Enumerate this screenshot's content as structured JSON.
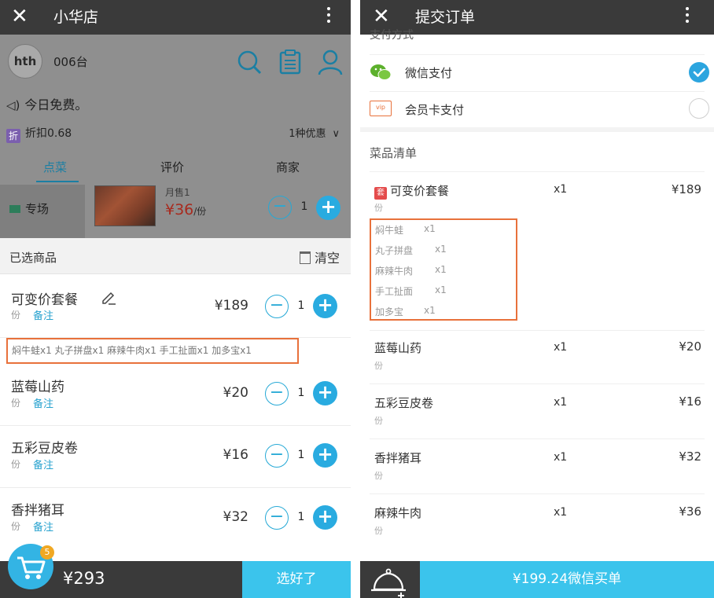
{
  "left": {
    "titlebar": {
      "close": "✕",
      "title": "小华店"
    },
    "store": {
      "logo": "hth",
      "table_no": "006台"
    },
    "notice": "今日免费。",
    "discount": {
      "badge": "折",
      "text": "折扣0.68"
    },
    "promo": {
      "text": "1种优惠",
      "chevron": "∨"
    },
    "tabs": [
      {
        "label": "点菜",
        "active": true
      },
      {
        "label": "评价"
      },
      {
        "label": "商家"
      }
    ],
    "category": "专场",
    "featured": {
      "sold": "月售1",
      "price": "¥36",
      "unit": "/份",
      "qty": "1"
    },
    "selected": {
      "title": "已选商品",
      "clear": "清空",
      "items": [
        {
          "name": "可变价套餐",
          "unit": "份",
          "note": "备注",
          "price": "¥189",
          "qty": "1"
        },
        {
          "name": "蓝莓山药",
          "unit": "份",
          "note": "备注",
          "price": "¥20",
          "qty": "1"
        },
        {
          "name": "五彩豆皮卷",
          "unit": "份",
          "note": "备注",
          "price": "¥16",
          "qty": "1"
        },
        {
          "name": "香拌猪耳",
          "unit": "份",
          "note": "备注",
          "price": "¥32",
          "qty": "1"
        }
      ],
      "subitems": "焖牛蛙x1  丸子拼盘x1  麻辣牛肉x1  手工扯面x1  加多宝x1"
    },
    "bottom": {
      "cart_count": "5",
      "total": "¥293",
      "done": "选好了"
    }
  },
  "right": {
    "titlebar": {
      "close": "✕",
      "title": "提交订单"
    },
    "payment_section": "支付方式",
    "payments": [
      {
        "label": "微信支付",
        "selected": true
      },
      {
        "label": "会员卡支付",
        "selected": false
      }
    ],
    "vip_icon": "vip",
    "menu_section": "菜品清单",
    "items": [
      {
        "badge": "套",
        "name": "可变价套餐",
        "unit": "份",
        "qty": "x1",
        "price": "¥189"
      },
      {
        "name": "蓝莓山药",
        "unit": "份",
        "qty": "x1",
        "price": "¥20"
      },
      {
        "name": "五彩豆皮卷",
        "unit": "份",
        "qty": "x1",
        "price": "¥16"
      },
      {
        "name": "香拌猪耳",
        "unit": "份",
        "qty": "x1",
        "price": "¥32"
      },
      {
        "name": "麻辣牛肉",
        "unit": "份",
        "qty": "x1",
        "price": "¥36"
      }
    ],
    "subitems": [
      {
        "name": "焖牛蛙",
        "qty": "x1"
      },
      {
        "name": "丸子拼盘",
        "qty": "x1"
      },
      {
        "name": "麻辣牛肉",
        "qty": "x1"
      },
      {
        "name": "手工扯面",
        "qty": "x1"
      },
      {
        "name": "加多宝",
        "qty": "x1"
      }
    ],
    "bottom": {
      "pay": "¥199.24微信买单"
    }
  },
  "colors": {
    "accent": "#29abe0",
    "price_red": "#a82a1e",
    "highlight": "#e8713b",
    "topbar": "#3a3a3a"
  },
  "icons": [
    "close-icon",
    "more-icon",
    "search-icon",
    "order-list-icon",
    "user-icon",
    "speaker-icon",
    "chevron-down-icon",
    "trash-icon",
    "edit-icon",
    "cart-icon",
    "wechat-icon",
    "vip-card-icon",
    "check-icon",
    "bell-icon"
  ]
}
